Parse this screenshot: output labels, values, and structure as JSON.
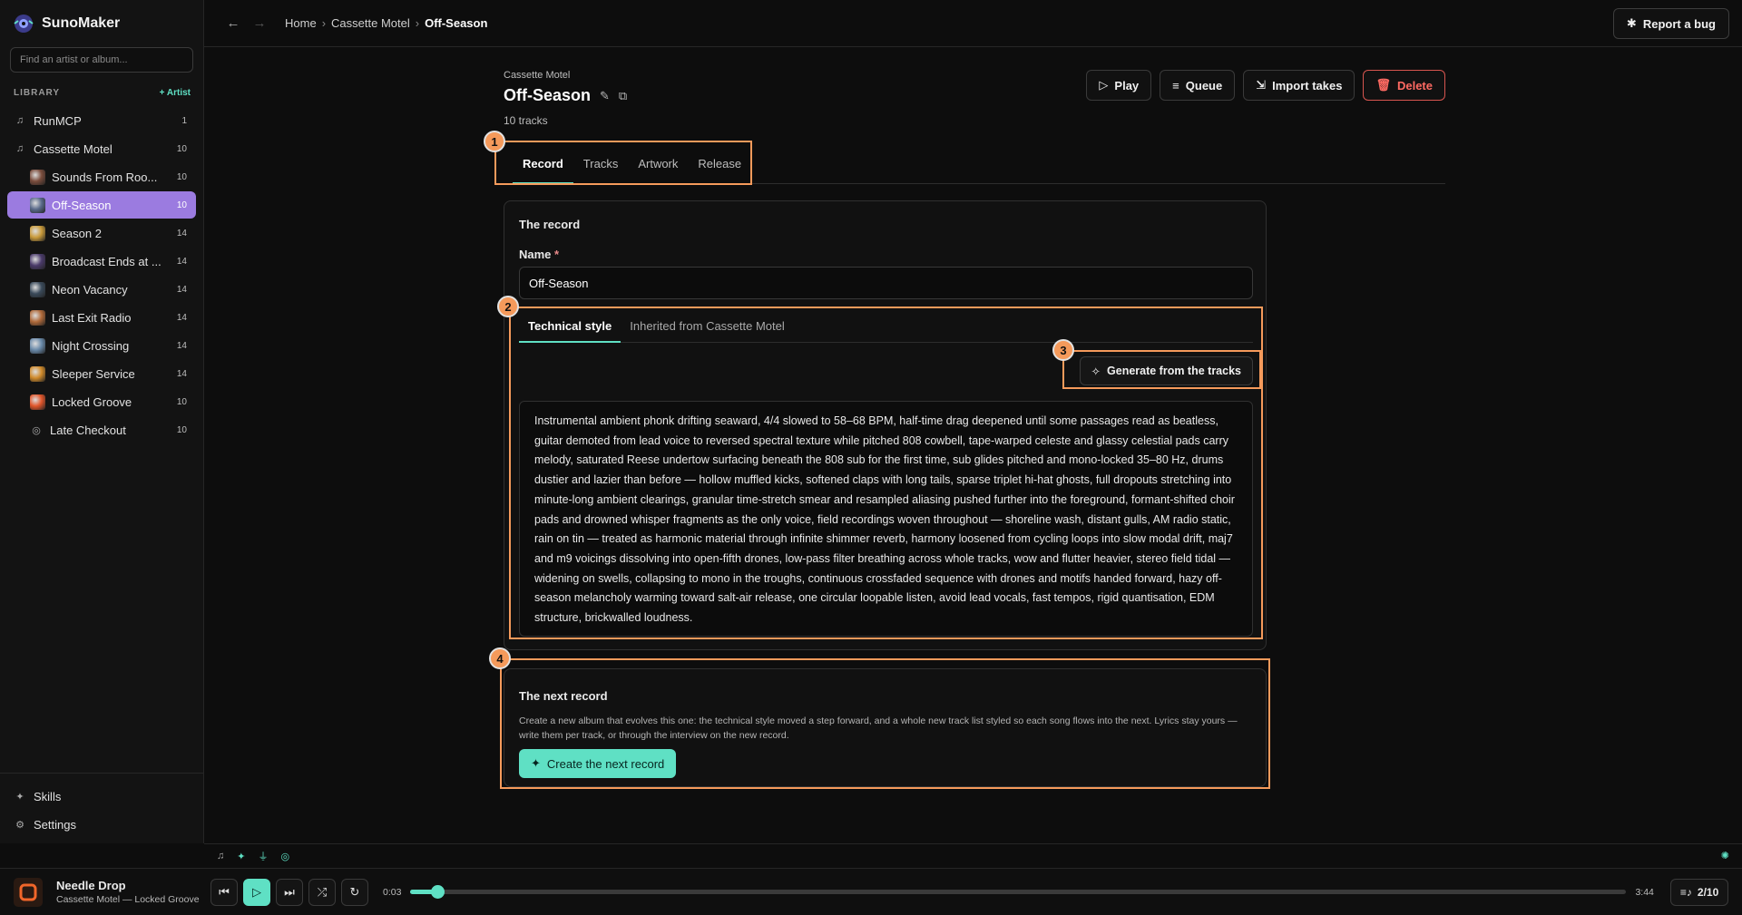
{
  "app": {
    "name": "SunoMaker"
  },
  "sidebar": {
    "search_placeholder": "Find an artist or album...",
    "library_title": "LIBRARY",
    "add_artist_label": "+ Artist",
    "items": [
      {
        "label": "RunMCP",
        "count": "1",
        "level": "artist"
      },
      {
        "label": "Cassette Motel",
        "count": "10",
        "level": "artist"
      },
      {
        "label": "Sounds From Roo...",
        "count": "10",
        "level": "album",
        "thumb": "#7a4c3c"
      },
      {
        "label": "Off-Season",
        "count": "10",
        "level": "album",
        "thumb": "#5a6a8a",
        "active": true
      },
      {
        "label": "Season 2",
        "count": "14",
        "level": "album",
        "thumb": "#c99a3a"
      },
      {
        "label": "Broadcast Ends at ...",
        "count": "14",
        "level": "album",
        "thumb": "#4a3a6a"
      },
      {
        "label": "Neon Vacancy",
        "count": "14",
        "level": "album",
        "thumb": "#3a4a5a"
      },
      {
        "label": "Last Exit Radio",
        "count": "14",
        "level": "album",
        "thumb": "#b06a3a"
      },
      {
        "label": "Night Crossing",
        "count": "14",
        "level": "album",
        "thumb": "#6a8aaa"
      },
      {
        "label": "Sleeper Service",
        "count": "14",
        "level": "album",
        "thumb": "#d08a2a"
      },
      {
        "label": "Locked Groove",
        "count": "10",
        "level": "album",
        "thumb": "#e0552a"
      },
      {
        "label": "Late Checkout",
        "count": "10",
        "level": "album-icon"
      }
    ],
    "bottom": [
      {
        "label": "Skills"
      },
      {
        "label": "Settings"
      }
    ]
  },
  "topbar": {
    "breadcrumb": [
      "Home",
      "Cassette Motel",
      "Off-Season"
    ],
    "report_label": "Report a bug"
  },
  "album": {
    "artist": "Cassette Motel",
    "title": "Off-Season",
    "track_count": "10 tracks",
    "actions": {
      "play": "Play",
      "queue": "Queue",
      "import": "Import takes",
      "delete": "Delete"
    },
    "tabs": [
      "Record",
      "Tracks",
      "Artwork",
      "Release"
    ],
    "active_tab": "Record"
  },
  "record": {
    "section_title": "The record",
    "name_label": "Name",
    "name_required": "*",
    "name_value": "Off-Season",
    "subtabs": [
      "Technical style",
      "Inherited from Cassette Motel"
    ],
    "generate_label": "Generate from the tracks",
    "style_text": "Instrumental ambient phonk drifting seaward, 4/4 slowed to 58–68 BPM, half-time drag deepened until some passages read as beatless, guitar demoted from lead voice to reversed spectral texture while pitched 808 cowbell, tape-warped celeste and glassy celestial pads carry melody, saturated Reese undertow surfacing beneath the 808 sub for the first time, sub glides pitched and mono-locked 35–80 Hz, drums dustier and lazier than before — hollow muffled kicks, softened claps with long tails, sparse triplet hi-hat ghosts, full dropouts stretching into minute-long ambient clearings, granular time-stretch smear and resampled aliasing pushed further into the foreground, formant-shifted choir pads and drowned whisper fragments as the only voice, field recordings woven throughout — shoreline wash, distant gulls, AM radio static, rain on tin — treated as harmonic material through infinite shimmer reverb, harmony loosened from cycling loops into slow modal drift, maj7 and m9 voicings dissolving into open-fifth drones, low-pass filter breathing across whole tracks, wow and flutter heavier, stereo field tidal — widening on swells, collapsing to mono in the troughs, continuous crossfaded sequence with drones and motifs handed forward, hazy off-season melancholy warming toward salt-air release, one circular loopable listen, avoid lead vocals, fast tempos, rigid quantisation, EDM structure, brickwalled loudness."
  },
  "next_record": {
    "title": "The next record",
    "description": "Create a new album that evolves this one: the technical style moved a step forward, and a whole new track list styled so each song flows into the next. Lyrics stay yours — write them per track, or through the interview on the new record.",
    "button": "Create the next record"
  },
  "annotations": [
    "1",
    "2",
    "3",
    "4"
  ],
  "player": {
    "title": "Needle Drop",
    "subtitle": "Cassette Motel — Locked Groove",
    "elapsed": "0:03",
    "duration": "3:44",
    "progress": 0.022,
    "queue_position": "2/10"
  },
  "colors": {
    "accent": "#5fe0c4",
    "active_nav": "#9b7be0",
    "danger": "#ff6a62",
    "annotation": "#f59a5b"
  }
}
